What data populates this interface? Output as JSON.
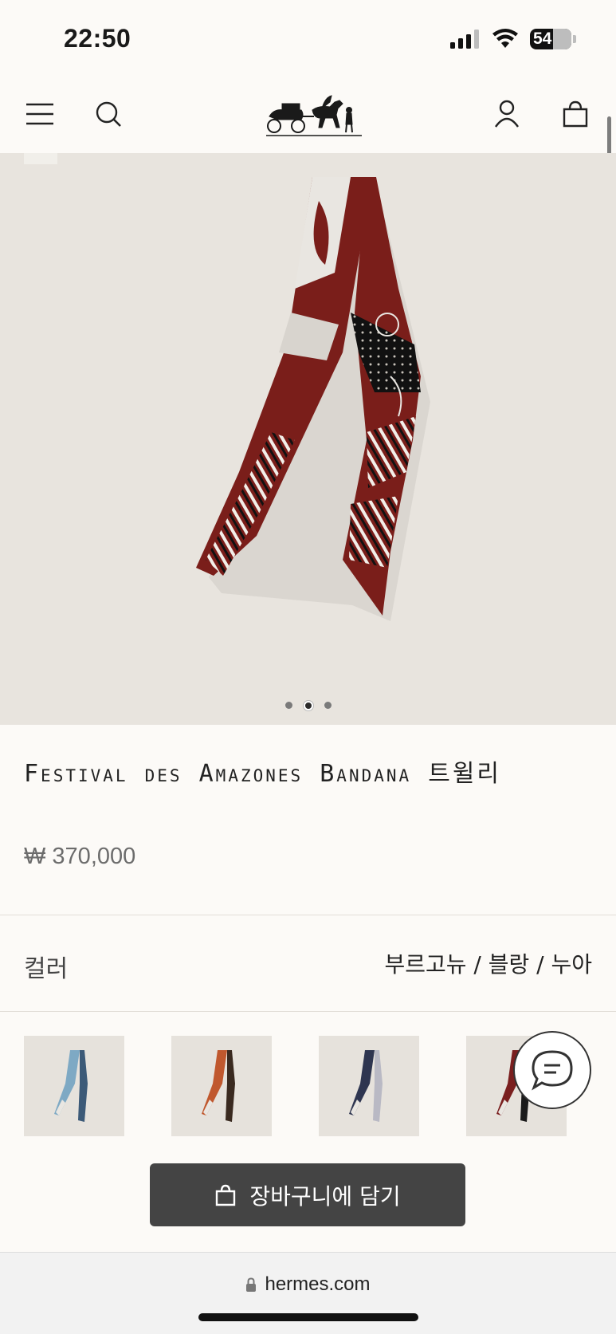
{
  "status_bar": {
    "time": "22:50",
    "battery": "54"
  },
  "header": {
    "menu_icon": "hamburger-menu-icon",
    "search_icon": "search-icon",
    "logo": "carriage-logo",
    "account_icon": "user-icon",
    "bag_icon": "shopping-bag-icon"
  },
  "gallery": {
    "slides": 3,
    "active_slide": 2
  },
  "product": {
    "title": "Festival des Amazones Bandana 트윌리",
    "price": "₩ 370,000"
  },
  "color": {
    "label": "컬러",
    "value": "부르고뉴 / 블랑 / 누아"
  },
  "swatches": [
    {
      "name": "blue-variant",
      "primary": "#7ea9c4",
      "secondary": "#3c5a78"
    },
    {
      "name": "orange-variant",
      "primary": "#c0582e",
      "secondary": "#3a2a20"
    },
    {
      "name": "navy-variant",
      "primary": "#2e3550",
      "secondary": "#b9b9c4"
    },
    {
      "name": "burgundy-variant",
      "primary": "#7a1f1f",
      "secondary": "#1a1a1a"
    }
  ],
  "actions": {
    "add_to_cart": "장바구니에 담기",
    "chat_icon": "chat-bubble-icon"
  },
  "browser": {
    "url": "hermes.com",
    "lock_icon": "lock-icon"
  },
  "colors": {
    "background": "#fcfaf7",
    "hero_bg": "#e8e4de",
    "button": "#444444",
    "scarf_burgundy": "#7a1e1a"
  }
}
